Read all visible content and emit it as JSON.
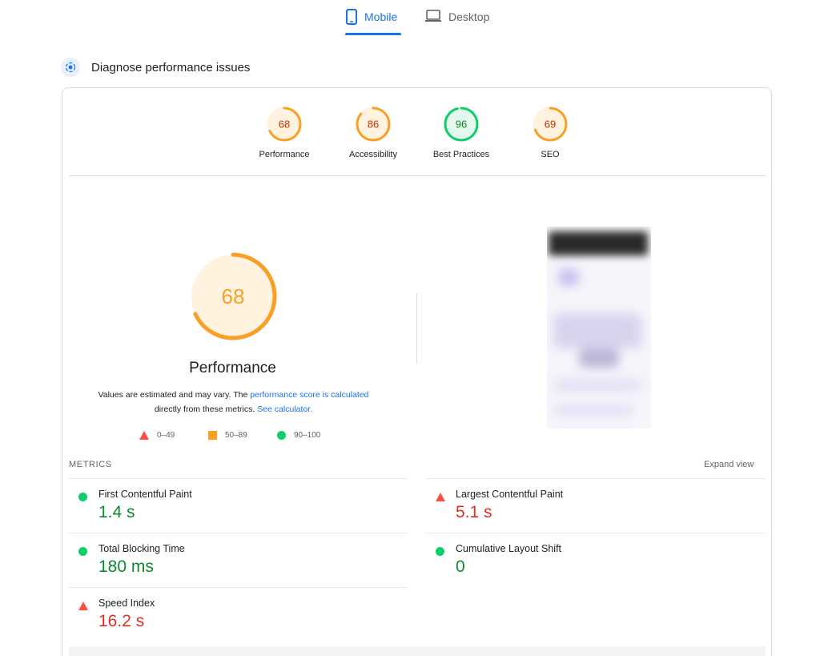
{
  "tabs": {
    "mobile": "Mobile",
    "desktop": "Desktop"
  },
  "section": {
    "title": "Diagnose performance issues"
  },
  "scores": [
    {
      "name": "Performance",
      "value": "68",
      "color": "#fa9f26"
    },
    {
      "name": "Accessibility",
      "value": "86",
      "color": "#fa9f26"
    },
    {
      "name": "Best Practices",
      "value": "96",
      "color": "#0cce6b"
    },
    {
      "name": "SEO",
      "value": "69",
      "color": "#fa9f26"
    }
  ],
  "performance": {
    "score": "68",
    "fraction": 0.68,
    "title": "Performance",
    "note_part1": "Values are estimated and may vary. The ",
    "note_link1": "performance score is calculated",
    "note_part2": "directly from these metrics. ",
    "note_link2": "See calculator."
  },
  "legend": {
    "poor": "0–49",
    "average": "50–89",
    "good": "90–100"
  },
  "metrics": {
    "header": "METRICS",
    "expand": "Expand view",
    "fcp": {
      "name": "First Contentful Paint",
      "value": "1.4 s"
    },
    "lcp": {
      "name": "Largest Contentful Paint",
      "value": "5.1 s"
    },
    "tbt": {
      "name": "Total Blocking Time",
      "value": "180 ms"
    },
    "cls": {
      "name": "Cumulative Layout Shift",
      "value": "0"
    },
    "si": {
      "name": "Speed Index",
      "value": "16.2 s"
    }
  },
  "colors": {
    "accent": "#1a73e8",
    "good": "#0cce6b",
    "average": "#fa9f26",
    "poor": "#ff4e42"
  }
}
